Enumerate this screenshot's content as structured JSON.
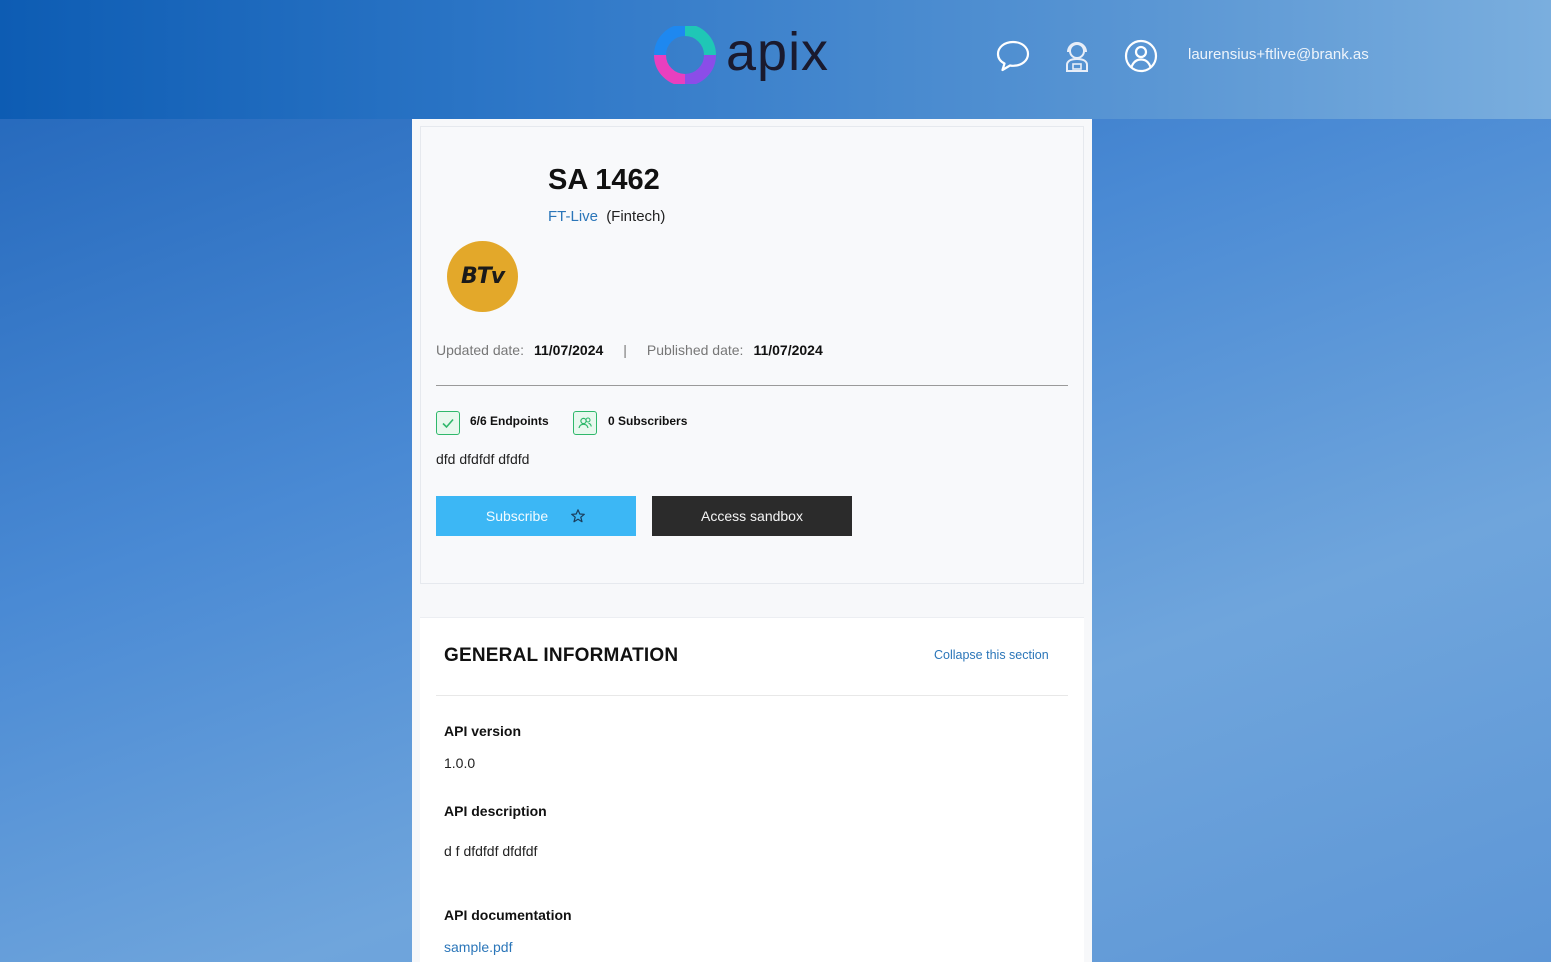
{
  "header": {
    "logo_text": "apix",
    "user_email": "laurensius+ftlive@brank.as",
    "icons": [
      "chat-icon",
      "support-agent-icon",
      "user-account-icon"
    ]
  },
  "api": {
    "title": "SA 1462",
    "avatar_text": "BTv",
    "provider": "FT-Live",
    "category": "(Fintech)",
    "updated_label": "Updated date:",
    "updated_value": "11/07/2024",
    "separator": "|",
    "published_label": "Published date:",
    "published_value": "11/07/2024",
    "endpoints": "6/6 Endpoints",
    "subscribers": "0 Subscribers",
    "short_description": "dfd dfdfdf dfdfd",
    "subscribe_label": "Subscribe",
    "sandbox_label": "Access sandbox"
  },
  "general_info": {
    "title": "GENERAL INFORMATION",
    "collapse_label": "Collapse this section",
    "version_label": "API version",
    "version_value": "1.0.0",
    "description_label": "API description",
    "description_value": "d f dfdfdf dfdfdf",
    "documentation_label": "API documentation",
    "documentation_value": "sample.pdf"
  },
  "colors": {
    "accent_blue": "#3cb7f5",
    "link_blue": "#2b76b9",
    "success_green": "#2fb86b",
    "dark_button": "#2b2b2b",
    "avatar_gold": "#e3a82a"
  }
}
